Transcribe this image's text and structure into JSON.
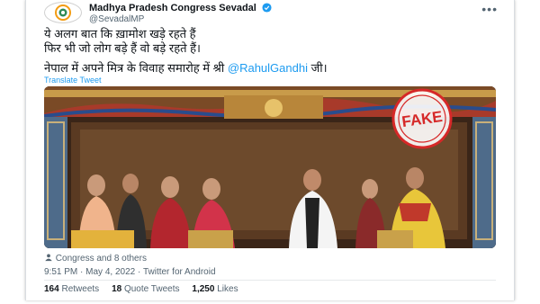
{
  "account": {
    "name": "Madhya Pradesh Congress Sevadal",
    "handle": "@SevadalMP"
  },
  "tweet": {
    "line1": "ये अलग बात कि ख़ामोश खड़े रहते हैं",
    "line2": "फिर भी जो लोग बड़े हैं वो बड़े रहते हैं।",
    "line3_prefix": "नेपाल में अपने मित्र के विवाह समारोह में श्री",
    "mention": "@RahulGandhi",
    "line3_suffix": "जी।",
    "translate": "Translate Tweet"
  },
  "media": {
    "stamp_text": "FAKE"
  },
  "tagged": "Congress and 8 others",
  "meta": {
    "time": "9:51 PM",
    "sep1": "·",
    "date": "May 4, 2022",
    "sep2": "·",
    "source": "Twitter for Android"
  },
  "stats": {
    "retweets_count": "164",
    "retweets_label": "Retweets",
    "quotes_count": "18",
    "quotes_label": "Quote Tweets",
    "likes_count": "1,250",
    "likes_label": "Likes"
  },
  "colors": {
    "link": "#1d9bf0",
    "verified": "#1d9bf0",
    "stamp": "#d62828"
  },
  "icons": {
    "more": "more-icon",
    "verified": "verified-badge-icon",
    "tag": "person-tag-icon"
  }
}
